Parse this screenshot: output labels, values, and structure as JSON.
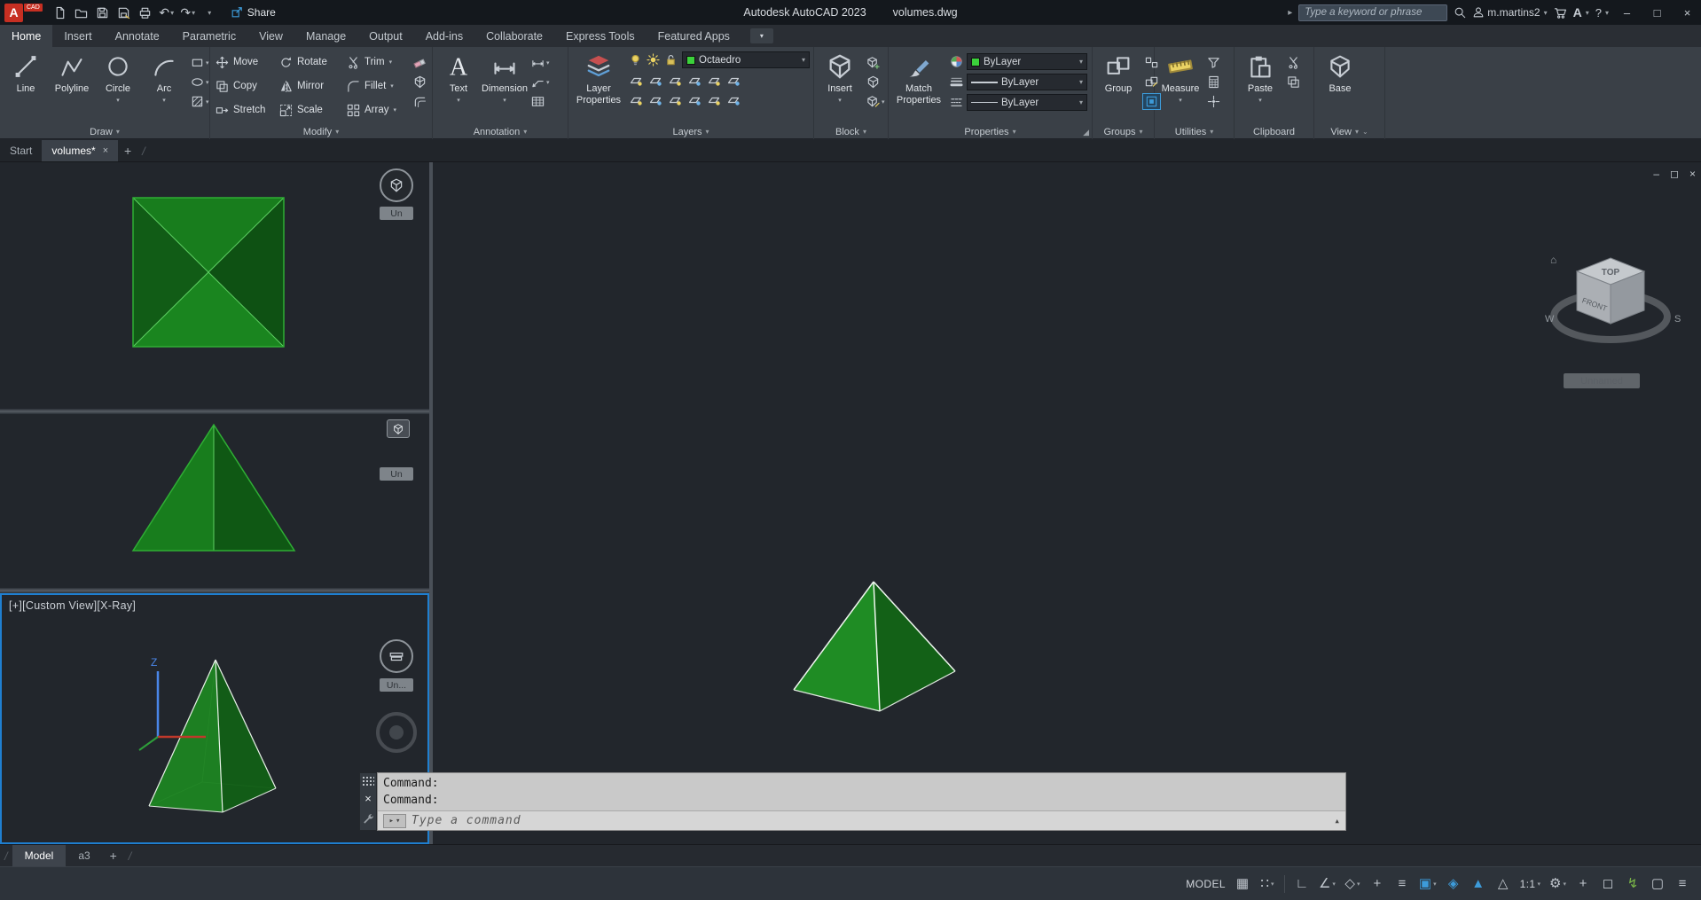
{
  "colors": {
    "accent_blue": "#3d9bd9",
    "selection_blue": "#1f7fd0",
    "titlebar_bg": "#14181d",
    "ribbon_bg": "#3a4047",
    "canvas_bg": "#22262c",
    "statusbar_bg": "#2d333a",
    "logo_red": "#c62f22",
    "layer_swatch_green": "#3bd23b",
    "pyramid_green_bright": "#1f8c24",
    "pyramid_green_mid": "#15691a",
    "pyramid_green_dark": "#0e5113",
    "pyramid_edge_green": "#34b93a"
  },
  "titlebar": {
    "logo_text": "A",
    "logo_tag": "CAD",
    "app_title": "Autodesk AutoCAD 2023",
    "doc_title": "volumes.dwg",
    "share_label": "Share",
    "search_placeholder": "Type a keyword or phrase",
    "username": "m.martins2",
    "quick_access": [
      {
        "name": "new-file-icon",
        "icon": "doc"
      },
      {
        "name": "open-file-icon",
        "icon": "folder"
      },
      {
        "name": "save-icon",
        "icon": "save"
      },
      {
        "name": "save-as-icon",
        "icon": "saveas"
      },
      {
        "name": "plot-icon",
        "icon": "plot"
      },
      {
        "name": "undo-icon",
        "glyph": "↶",
        "caret": true
      },
      {
        "name": "redo-icon",
        "glyph": "↷",
        "caret": true
      }
    ]
  },
  "ribbon_tabs": [
    {
      "label": "Home",
      "active": true
    },
    {
      "label": "Insert"
    },
    {
      "label": "Annotate"
    },
    {
      "label": "Parametric"
    },
    {
      "label": "View"
    },
    {
      "label": "Manage"
    },
    {
      "label": "Output"
    },
    {
      "label": "Add-ins"
    },
    {
      "label": "Collaborate"
    },
    {
      "label": "Express Tools"
    },
    {
      "label": "Featured Apps"
    }
  ],
  "panels": {
    "draw": {
      "label": "Draw",
      "buttons": [
        {
          "label": "Line",
          "icon": "line"
        },
        {
          "label": "Polyline",
          "icon": "polyline"
        },
        {
          "label": "Circle",
          "icon": "circle",
          "flyout": true
        },
        {
          "label": "Arc",
          "icon": "arc",
          "flyout": true
        }
      ],
      "side": [
        {
          "name": "rectangle-icon",
          "icon": "rectangle",
          "caret": true
        },
        {
          "name": "ellipse-icon",
          "icon": "ellipse",
          "caret": true
        },
        {
          "name": "hatch-icon",
          "icon": "hatch",
          "caret": true
        }
      ]
    },
    "modify": {
      "label": "Modify",
      "items": [
        {
          "label": "Move",
          "icon": "move"
        },
        {
          "label": "Rotate",
          "icon": "rotate"
        },
        {
          "label": "Trim",
          "icon": "trim",
          "flyout": true
        },
        {
          "label": "Copy",
          "icon": "copy"
        },
        {
          "label": "Mirror",
          "icon": "mirror"
        },
        {
          "label": "Fillet",
          "icon": "fillet",
          "flyout": true
        },
        {
          "label": "Stretch",
          "icon": "stretch"
        },
        {
          "label": "Scale",
          "icon": "scale"
        },
        {
          "label": "Array",
          "icon": "array",
          "flyout": true
        }
      ],
      "side": [
        {
          "name": "erase-icon",
          "icon": "erase"
        },
        {
          "name": "explode-icon",
          "icon": "explode"
        },
        {
          "name": "offset-icon",
          "icon": "offset"
        }
      ]
    },
    "annotation": {
      "label": "Annotation",
      "buttons": [
        {
          "label": "Text",
          "icon": "text",
          "flyout": true
        },
        {
          "label": "Dimension",
          "icon": "dimension",
          "flyout": true
        }
      ],
      "side": [
        {
          "name": "linear-dimension-icon",
          "icon": "dimension",
          "caret": true
        },
        {
          "name": "leader-icon",
          "icon": "leader",
          "caret": true
        },
        {
          "name": "table-icon",
          "icon": "table"
        }
      ]
    },
    "layers": {
      "label": "Layers",
      "big_label": "Layer Properties",
      "active_layer": "Octaedro",
      "state_icons": [
        {
          "name": "layer-on-icon",
          "icon": "bulb"
        },
        {
          "name": "layer-thaw-icon",
          "icon": "sun"
        },
        {
          "name": "layer-unlock-icon",
          "icon": "lock"
        }
      ],
      "tool_icons_row1": [
        "layer-off-icon",
        "layer-freeze-icon",
        "layer-lock-icon",
        "layer-color-icon",
        "layer-match-icon",
        "layer-previous-icon"
      ],
      "tool_icons_row2": [
        "layer-isolate-icon",
        "layer-unisolate-icon",
        "layer-merge-icon",
        "layer-delete-icon",
        "layer-walk-icon",
        "layer-state-icon"
      ]
    },
    "block": {
      "label": "Block",
      "big_label": "Insert",
      "side": [
        {
          "name": "create-block-icon",
          "icon": "cubeplus"
        },
        {
          "name": "write-block-icon",
          "icon": "cube"
        },
        {
          "name": "block-editor-icon",
          "icon": "cubepencil",
          "caret": true
        }
      ]
    },
    "properties": {
      "label": "Properties",
      "big_label": "Match Properties",
      "rows": [
        {
          "name": "object-color-control",
          "icon": "colorwheel",
          "value": "ByLayer",
          "swatch": "#3bd23b"
        },
        {
          "name": "lineweight-control",
          "icon": "lwicon",
          "value": "ByLayer"
        },
        {
          "name": "linetype-control",
          "icon": "lticon",
          "value": "ByLayer"
        }
      ]
    },
    "groups": {
      "label": "Groups",
      "big_label": "Group",
      "side": [
        {
          "name": "ungroup-icon",
          "icon": "ungroup"
        },
        {
          "name": "group-edit-icon",
          "icon": "groupedit"
        },
        {
          "name": "group-selection-icon",
          "icon": "groupsel",
          "active": true
        }
      ]
    },
    "utilities": {
      "label": "Utilities",
      "big_label": "Measure",
      "big_flyout": true,
      "side": [
        {
          "name": "quick-select-icon",
          "icon": "qselect"
        },
        {
          "name": "quick-calc-icon",
          "icon": "qcalc"
        },
        {
          "name": "id-point-icon",
          "icon": "idpoint"
        }
      ]
    },
    "clipboard": {
      "label": "Clipboard",
      "big_label": "Paste",
      "big_flyout": true,
      "side": [
        {
          "name": "cut-icon",
          "icon": "trim"
        },
        {
          "name": "copy-clip-icon",
          "icon": "copy"
        }
      ]
    },
    "view": {
      "label": "View",
      "big_label": "Base"
    }
  },
  "file_tabs": {
    "tabs": [
      {
        "label": "Start"
      },
      {
        "label": "volumes*",
        "active": true,
        "closable": true
      }
    ],
    "new_tab_label": "+"
  },
  "viewports": {
    "vp3_label": "[+][Custom View][X-Ray]",
    "mini_nav_labels": [
      "Un",
      "Un",
      "Un..."
    ],
    "viewcube": {
      "top": "TOP",
      "front": "FRONT",
      "west": "W",
      "south": "S",
      "home_glyph": "⌂",
      "ucs_label": "Unnamed"
    }
  },
  "command_line": {
    "history": [
      "Command:",
      "Command:"
    ],
    "placeholder": "Type a command"
  },
  "layout_tabs": {
    "tabs": [
      {
        "label": "Model",
        "active": true
      },
      {
        "label": "a3"
      }
    ],
    "new_label": "+"
  },
  "status_bar": {
    "items": [
      {
        "name": "model-toggle",
        "label": "MODEL"
      },
      {
        "name": "grid-display-icon",
        "glyph": "▦"
      },
      {
        "name": "snap-mode-icon",
        "glyph": "∷",
        "caret": true
      },
      {
        "name": "separator"
      },
      {
        "name": "ortho-mode-icon",
        "glyph": "∟"
      },
      {
        "name": "polar-tracking-icon",
        "glyph": "∠",
        "caret": true
      },
      {
        "name": "isometric-drafting-icon",
        "glyph": "◇",
        "caret": true
      },
      {
        "name": "object-snap-tracking-icon",
        "glyph": "+"
      },
      {
        "name": "lineweight-display-icon",
        "glyph": "≡"
      },
      {
        "name": "selection-cycling-icon",
        "glyph": "▣",
        "caret": true,
        "accent": true
      },
      {
        "name": "object-snap-icon",
        "glyph": "◈",
        "accent": true
      },
      {
        "name": "annotation-visibility-icon",
        "glyph": "▲",
        "accent": true
      },
      {
        "name": "autoscale-icon",
        "glyph": "△"
      },
      {
        "name": "annotation-scale",
        "label": "1:1",
        "caret": true
      },
      {
        "name": "workspace-switching-icon",
        "glyph": "⚙",
        "caret": true
      },
      {
        "name": "annotation-monitor-icon",
        "glyph": "+"
      },
      {
        "name": "isolate-objects-icon",
        "glyph": "◻"
      },
      {
        "name": "graphics-performance-icon",
        "glyph": "↯",
        "green": true
      },
      {
        "name": "clean-screen-icon",
        "glyph": "▢"
      },
      {
        "name": "customization-icon",
        "glyph": "≡"
      }
    ]
  }
}
